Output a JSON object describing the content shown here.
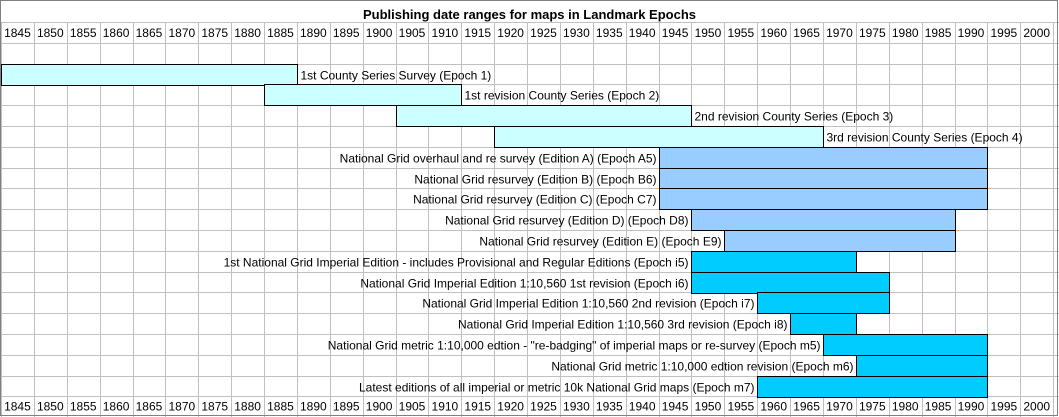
{
  "chart_data": {
    "type": "bar",
    "orientation": "horizontal-range",
    "title": "Publishing date ranges for maps in Landmark Epochs",
    "xlabel": "",
    "ylabel": "",
    "xlim": [
      1845,
      2005
    ],
    "grid": true,
    "ticks": [
      "1845",
      "1850",
      "1855",
      "1860",
      "1865",
      "1870",
      "1875",
      "1880",
      "1885",
      "1890",
      "1895",
      "1900",
      "1905",
      "1910",
      "1915",
      "1920",
      "1925",
      "1930",
      "1935",
      "1940",
      "1945",
      "1950",
      "1955",
      "1960",
      "1965",
      "1970",
      "1975",
      "1980",
      "1985",
      "1990",
      "1995",
      "2000"
    ],
    "series": [
      {
        "label": "1st County Series Survey (Epoch 1)",
        "start": 1845,
        "end": 1890,
        "color": "#ccffff",
        "label_side": "right"
      },
      {
        "label": "1st revision  County Series (Epoch 2)",
        "start": 1885,
        "end": 1915,
        "color": "#ccffff",
        "label_side": "right"
      },
      {
        "label": "2nd revision County Series (Epoch 3)",
        "start": 1905,
        "end": 1950,
        "color": "#ccffff",
        "label_side": "right"
      },
      {
        "label": "3rd revision County Series (Epoch 4)",
        "start": 1920,
        "end": 1970,
        "color": "#ccffff",
        "label_side": "right"
      },
      {
        "label": "National Grid overhaul and re survey (Edition A) (Epoch A5)",
        "start": 1945,
        "end": 1995,
        "color": "#99ccff",
        "label_side": "left"
      },
      {
        "label": "National Grid resurvey (Edition B) (Epoch B6)",
        "start": 1945,
        "end": 1995,
        "color": "#99ccff",
        "label_side": "left"
      },
      {
        "label": "National Grid resurvey (Edition C) (Epoch C7)",
        "start": 1945,
        "end": 1995,
        "color": "#99ccff",
        "label_side": "left"
      },
      {
        "label": "National Grid resurvey (Edition D) (Epoch D8)",
        "start": 1950,
        "end": 1990,
        "color": "#99ccff",
        "label_side": "left"
      },
      {
        "label": "National Grid resurvey (Edition E) (Epoch E9)",
        "start": 1955,
        "end": 1990,
        "color": "#99ccff",
        "label_side": "left"
      },
      {
        "label": "1st National Grid Imperial Edition - includes Provisional and Regular Editions (Epoch i5)",
        "start": 1950,
        "end": 1975,
        "color": "#00ccff",
        "label_side": "left"
      },
      {
        "label": "National Grid Imperial Edition 1:10,560 1st revision (Epoch i6)",
        "start": 1950,
        "end": 1980,
        "color": "#00ccff",
        "label_side": "left"
      },
      {
        "label": "National Grid Imperial Edition 1:10,560 2nd revision (Epoch i7)",
        "start": 1960,
        "end": 1980,
        "color": "#00ccff",
        "label_side": "left"
      },
      {
        "label": "National Grid Imperial Edition 1:10,560 3rd revision (Epoch i8)",
        "start": 1965,
        "end": 1975,
        "color": "#00ccff",
        "label_side": "left"
      },
      {
        "label": "National Grid metric 1:10,000 edtion - \"re-badging\" of imperial maps or re-survey (Epoch m5)",
        "start": 1970,
        "end": 1995,
        "color": "#00ccff",
        "label_side": "left"
      },
      {
        "label": "National Grid metric 1:10,000 edtion revision (Epoch m6)",
        "start": 1975,
        "end": 1995,
        "color": "#00ccff",
        "label_side": "left"
      },
      {
        "label": "Latest editions of all imperial or metric 10k National Grid maps (Epoch m7)",
        "start": 1960,
        "end": 1995,
        "color": "#00ccff",
        "label_side": "left"
      }
    ]
  }
}
